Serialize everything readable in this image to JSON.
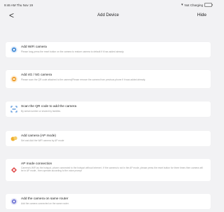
{
  "status_bar": {
    "time": "9:46 AM  Thu Nov 19",
    "charging": "Not Charging"
  },
  "nav": {
    "back": "<",
    "title": "Add Device",
    "hide": "Hide"
  },
  "options": [
    {
      "title": "Add WiFi camera",
      "description": "Please long-press the reset button on the camera to restore camera to default if it has added already.",
      "icon": "wifi-camera-icon",
      "color": "#4a90d9"
    },
    {
      "title": "Add 4G / 5G camera",
      "description": "Please scan the QR code attached to the camera(Please remove the camera from previous phone if it was added already.",
      "icon": "cellular-camera-icon",
      "color": "#f0a030"
    },
    {
      "title": "Scan the QR code to add the camera",
      "description": "By serial number or shared by families.",
      "icon": "qr-scan-icon",
      "color": "#3f86d6"
    },
    {
      "title": "Add camera (AP mode)",
      "description": "Set and Add the WiFi camera by AP mode",
      "icon": "ap-camera-icon",
      "color": "#f0b030"
    },
    {
      "title": "AP mode connection",
      "description": "Camera's WiFi as the hotspot, phone connected to the hotspot without Internet ; If the camera is not in the AP mode, please press the reset button for three times then camera will be in AP mode , then operate according to the voice prompt",
      "icon": "ap-connection-icon",
      "color": "#e04848"
    },
    {
      "title": "Add the camera on same router",
      "description": "Add the camera connected on the same router.",
      "icon": "router-camera-icon",
      "color": "#7a7fd8"
    }
  ]
}
